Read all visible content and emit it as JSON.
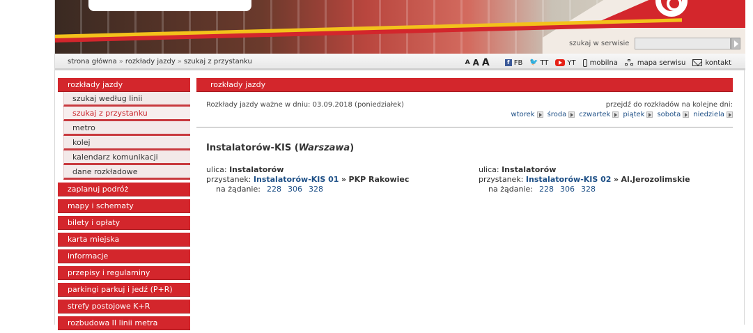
{
  "search": {
    "label": "szukaj w serwisie",
    "value": ""
  },
  "breadcrumb": {
    "home": "strona główna",
    "sep": "»",
    "level2": "rozkłady jazdy",
    "current": "szukaj z przystanku"
  },
  "toolbar": {
    "font_small": "A",
    "font_medium": "A",
    "font_large": "A",
    "fb": "FB",
    "tt": "TT",
    "yt": "YT",
    "mobile": "mobilna",
    "sitemap": "mapa serwisu",
    "contact": "kontakt"
  },
  "sidebar": {
    "section_title": "rozkłady jazdy",
    "subitems": [
      "szukaj według linii",
      "szukaj z przystanku",
      "metro",
      "kolej",
      "kalendarz komunikacji",
      "dane rozkładowe"
    ],
    "active_subitem": "szukaj z przystanku",
    "items": [
      "zaplanuj podróż",
      "mapy i schematy",
      "bilety i opłaty",
      "karta miejska",
      "informacje",
      "przepisy i regulaminy",
      "parkingi parkuj i jedź (P+R)",
      "strefy postojowe K+R",
      "rozbudowa II linii metra"
    ]
  },
  "main": {
    "header": "rozkłady jazdy",
    "validity": "Rozkłady jazdy ważne w dniu: 03.09.2018 (poniedziałek)",
    "days_label": "przejdź do rozkładów na kolejne dni:",
    "days": [
      "wtorek",
      "środa",
      "czwartek",
      "piątek",
      "sobota",
      "niedziela"
    ],
    "stop_name": "Instalatorów-KIS",
    "city": "Warszawa",
    "stops": [
      {
        "street_label": "ulica:",
        "street": "Instalatorów",
        "stop_label": "przystanek:",
        "stop": "Instalatorów-KIS 01",
        "sep": "»",
        "direction": "PKP Rakowiec",
        "on_demand_label": "na żądanie:",
        "lines": [
          "228",
          "306",
          "328"
        ]
      },
      {
        "street_label": "ulica:",
        "street": "Instalatorów",
        "stop_label": "przystanek:",
        "stop": "Instalatorów-KIS 02",
        "sep": "»",
        "direction": "Al.Jerozolimskie",
        "on_demand_label": "na żądanie:",
        "lines": [
          "228",
          "306",
          "328"
        ]
      }
    ]
  }
}
